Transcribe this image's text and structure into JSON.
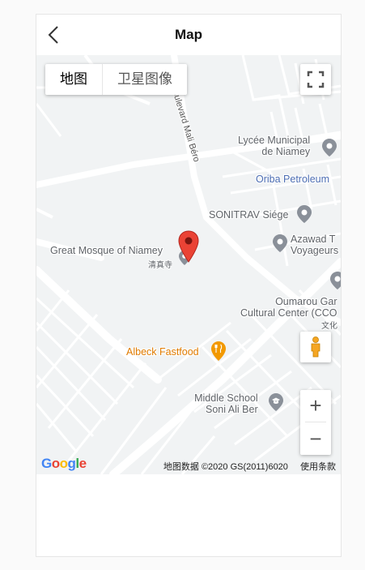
{
  "header": {
    "title": "Map"
  },
  "map_type": {
    "map_label": "地图",
    "satellite_label": "卫星图像"
  },
  "places": {
    "lycee": [
      "Lycée Municipal",
      "de Niamey"
    ],
    "oriba": "Oriba Petroleum",
    "sonitrav": "SONITRAV Siége",
    "azawad": [
      "Azawad T",
      "Voyageurs"
    ],
    "mosque": "Great Mosque of Niamey",
    "mosque_cn": "清真寺",
    "oumarou": [
      "Oumarou Gar",
      "Cultural Center (CCO"
    ],
    "oumarou_cn": "文化",
    "albeck": "Albeck Fastfood",
    "school": [
      "Middle School",
      "Soni Ali Ber"
    ]
  },
  "roads": {
    "boulevard": "oulevard Mali Béro"
  },
  "footer": {
    "logo": "Google",
    "map_data": "地图数据 ©2020 GS(2011)6020",
    "terms": "使用条款"
  },
  "controls": {
    "zoom_in": "+",
    "zoom_out": "−"
  },
  "colors": {
    "map_bg": "#f1f3f4",
    "road": "#ffffff",
    "pin": "#ea4335",
    "poi_gray": "#5f6368",
    "poi_blue": "#4d6eb3",
    "poi_orange": "#e07b00",
    "pegman": "#f5a623"
  },
  "icons": {
    "back": "chevron-left-icon",
    "fullscreen": "fullscreen-icon",
    "pegman": "pegman-icon",
    "pin": "map-pin-icon"
  }
}
